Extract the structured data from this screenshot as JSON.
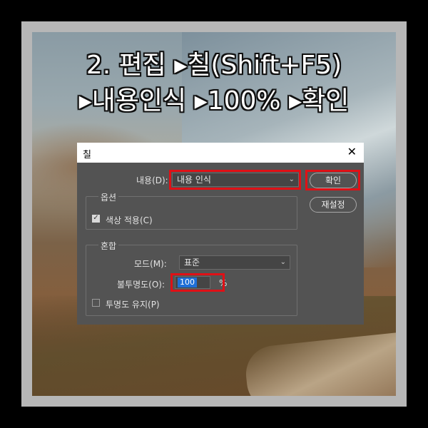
{
  "headline": {
    "line1": "2. 편집 ▸칠(Shift+F5)",
    "line2": "▸내용인식 ▸100% ▸확인"
  },
  "dialog": {
    "title": "칠",
    "close_glyph": "✕",
    "content_label": "내용(D):",
    "content_value": "내용 인식",
    "ok_label": "확인",
    "reset_label": "재설정",
    "options": {
      "group_title": "옵션",
      "color_adapt_label": "색상 적용(C)",
      "color_adapt_checked": true
    },
    "blend": {
      "group_title": "혼합",
      "mode_label": "모드(M):",
      "mode_value": "표준",
      "opacity_label": "불투명도(O):",
      "opacity_value": "100",
      "opacity_unit": "%",
      "preserve_label": "투명도 유지(P)",
      "preserve_checked": false
    }
  },
  "colors": {
    "highlight_red": "#e01016",
    "dialog_bg": "#535353",
    "selection_blue": "#1f6fd6"
  }
}
